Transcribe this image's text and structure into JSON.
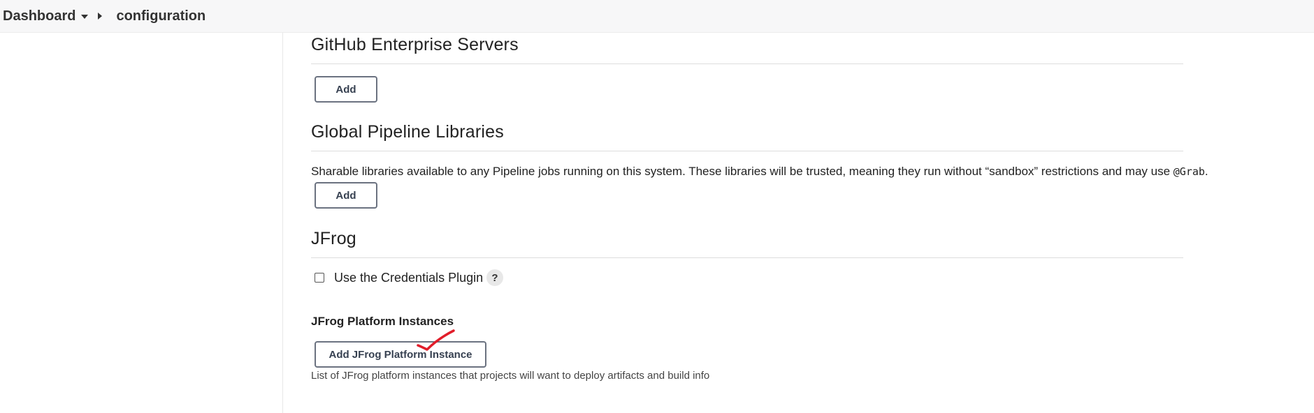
{
  "breadcrumb": {
    "dashboard": "Dashboard",
    "configuration": "configuration"
  },
  "github_enterprise": {
    "title": "GitHub Enterprise Servers",
    "add_label": "Add"
  },
  "pipeline_libraries": {
    "title": "Global Pipeline Libraries",
    "description_pre": "Sharable libraries available to any Pipeline jobs running on this system. These libraries will be trusted, meaning they run without “sandbox” restrictions and may use ",
    "description_code": "@Grab",
    "description_post": ".",
    "add_label": "Add"
  },
  "jfrog": {
    "title": "JFrog",
    "credentials_label": "Use the Credentials Plugin",
    "credentials_checked": false,
    "help_label": "?",
    "instances_title": "JFrog Platform Instances",
    "add_instance_label": "Add JFrog Platform Instance",
    "instances_hint": "List of JFrog platform instances that projects will want to deploy artifacts and build info"
  },
  "colors": {
    "annotation_check": "#e11d2a",
    "button_border": "#6b7280"
  },
  "icons": [
    "chevron-down-icon",
    "breadcrumb-separator-icon",
    "help-icon",
    "checkbox-icon",
    "red-checkmark-annotation"
  ]
}
